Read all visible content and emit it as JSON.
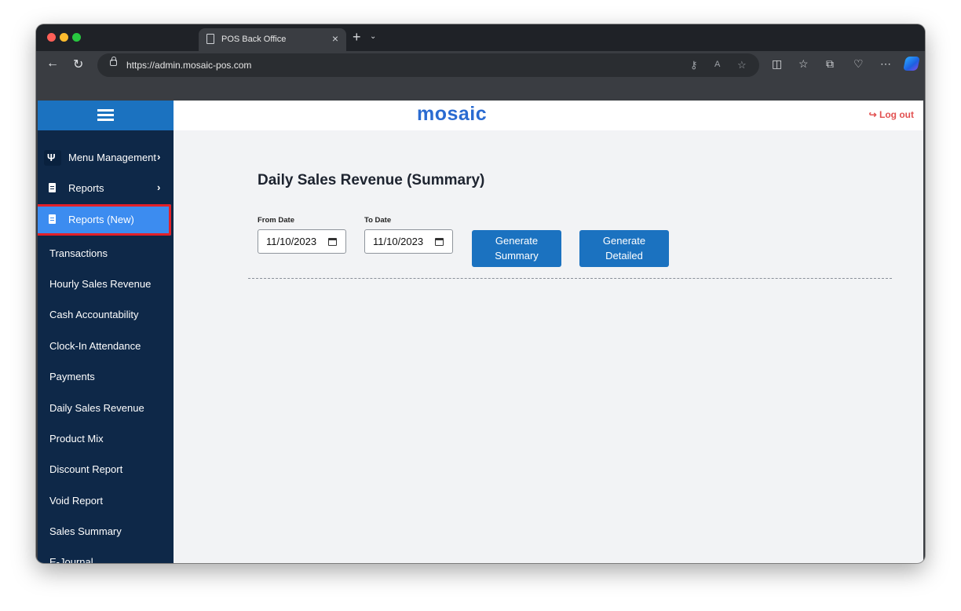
{
  "browser": {
    "tab_title": "POS Back Office",
    "tab_close": "×",
    "new_tab": "+",
    "tab_menu": "⌄",
    "back": "←",
    "reload": "↻",
    "url": "https://admin.mosaic-pos.com"
  },
  "app": {
    "logo": "mosaic",
    "logout_label": "Log out",
    "logout_icon": "↪"
  },
  "sidebar": {
    "groups": [
      {
        "label": "Menu Management",
        "icon": "fork-knife-icon",
        "chevron": "›"
      },
      {
        "label": "Reports",
        "icon": "document-icon",
        "chevron": "›"
      },
      {
        "label": "Reports (New)",
        "icon": "document-icon",
        "active": true
      }
    ],
    "report_links": [
      "Transactions",
      "Hourly Sales Revenue",
      "Cash Accountability",
      "Clock-In Attendance",
      "Payments",
      "Daily Sales Revenue",
      "Product Mix",
      "Discount Report",
      "Void Report",
      "Sales Summary",
      "E-Journal"
    ]
  },
  "report": {
    "title": "Daily Sales Revenue (Summary)",
    "from_label": "From Date",
    "from_value": "11/10/2023",
    "to_label": "To Date",
    "to_value": "11/10/2023",
    "generate_summary_line1": "Generate",
    "generate_summary_line2": "Summary",
    "generate_detailed_line1": "Generate",
    "generate_detailed_line2": "Detailed"
  },
  "colors": {
    "sidebar_bg": "#0e2848",
    "accent_blue": "#1b72c0",
    "active_item": "#3c8cf0",
    "highlight_outline": "#e32028",
    "logout_red": "#e25151"
  }
}
